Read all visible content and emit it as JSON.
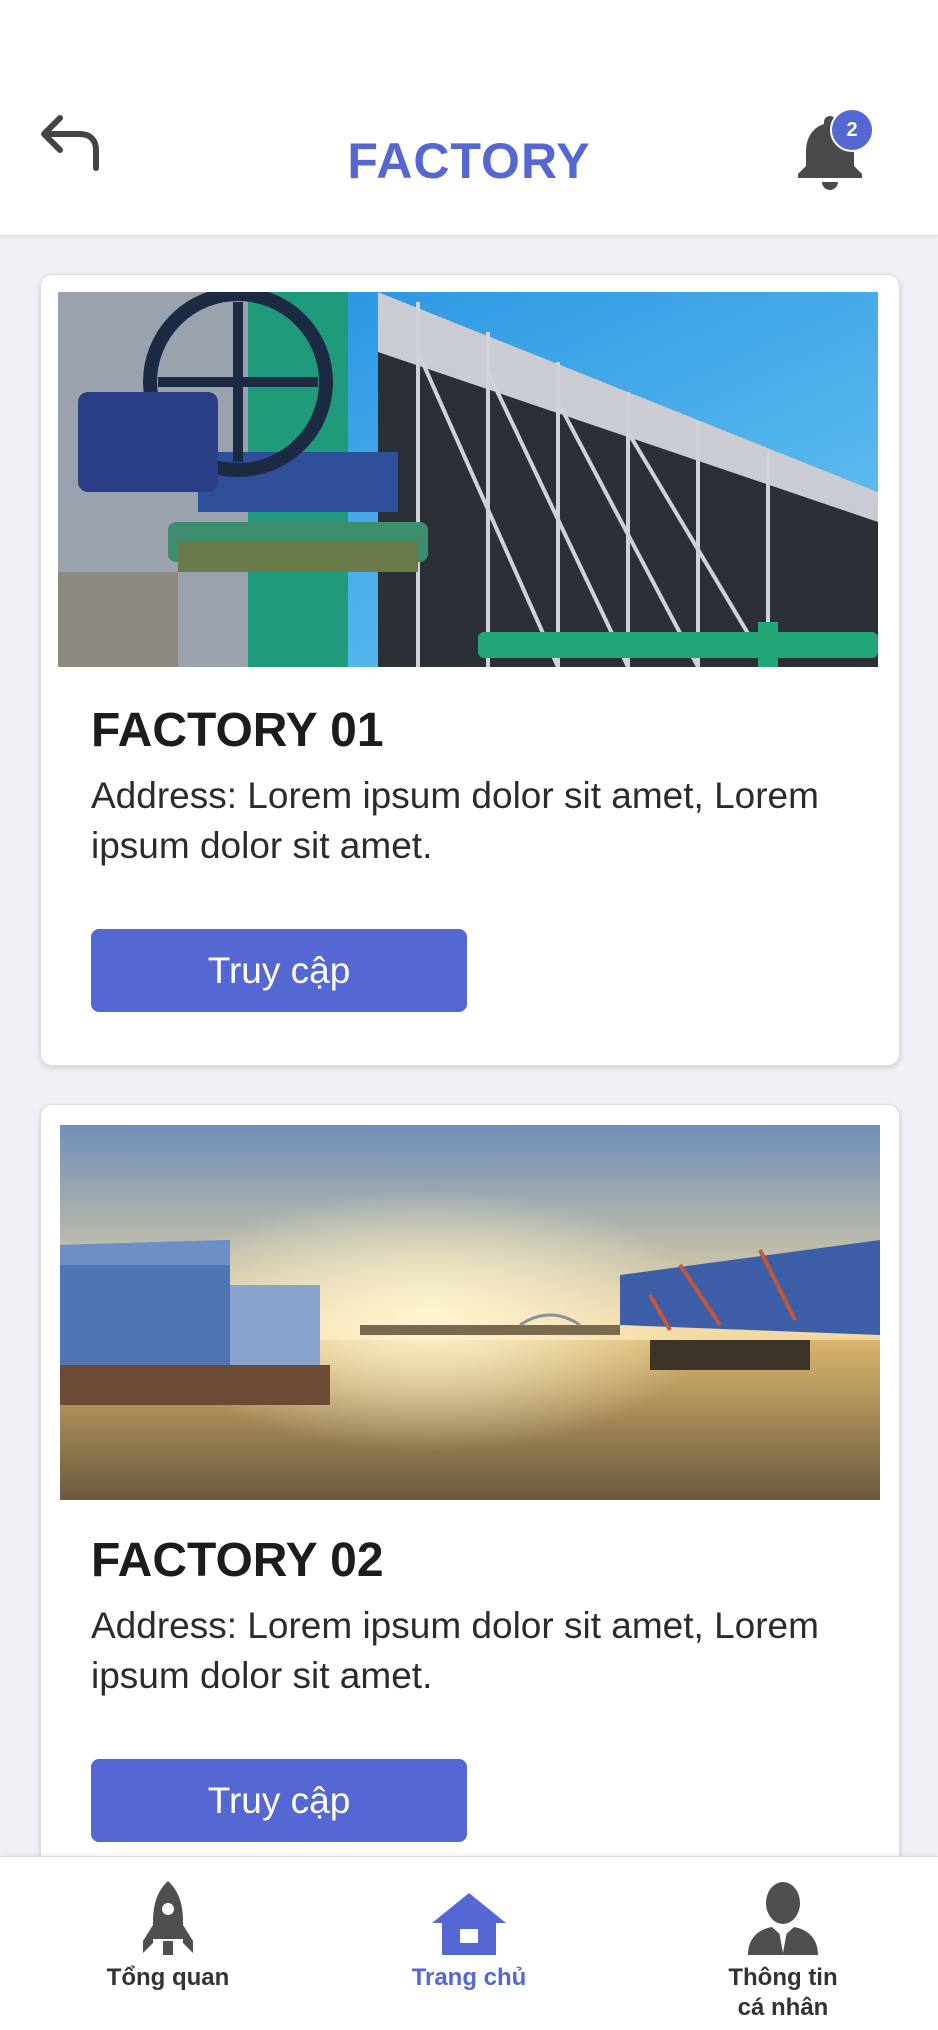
{
  "header": {
    "title": "FACTORY",
    "notification_count": "2",
    "back_icon": "back-arrow-icon",
    "bell_icon": "bell-icon"
  },
  "factories": [
    {
      "name": "FACTORY 01",
      "address": "Address: Lorem ipsum dolor sit amet, Lorem ipsum dolor sit amet.",
      "button_label": "Truy cập",
      "image": "cooling-tower-pipes-photo"
    },
    {
      "name": "FACTORY 02",
      "address": "Address: Lorem ipsum dolor sit amet, Lorem ipsum dolor sit amet.",
      "button_label": "Truy cập",
      "image": "industrial-harbor-sunset-photo"
    }
  ],
  "bottom_nav": {
    "items": [
      {
        "label": "Tổng quan",
        "icon": "rocket-icon",
        "active": false
      },
      {
        "label": "Trang chủ",
        "icon": "home-icon",
        "active": true
      },
      {
        "label_line1": "Thông tin",
        "label_line2": "cá nhân",
        "icon": "user-icon",
        "active": false
      }
    ]
  },
  "colors": {
    "accent": "#5567d3",
    "background": "#eff1f7",
    "card": "#ffffff",
    "text_dark": "#1c1c1c"
  }
}
